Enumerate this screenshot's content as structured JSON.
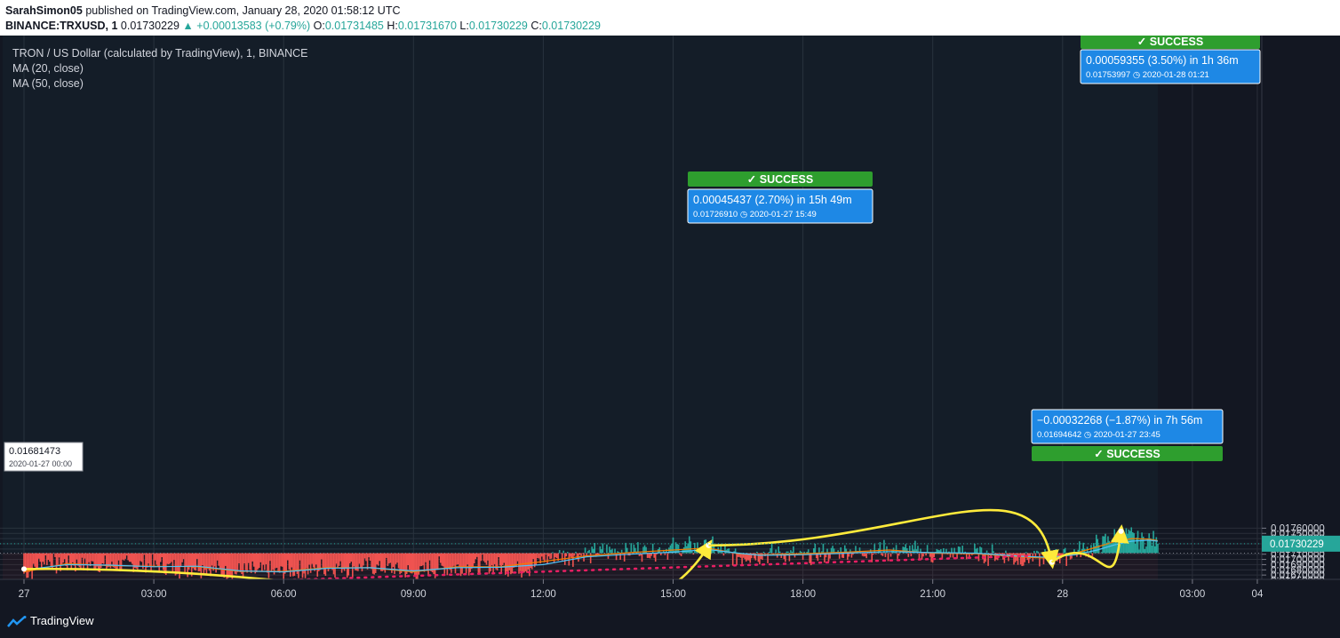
{
  "header": {
    "author": "SarahSimon05",
    "published_text": "published on TradingView.com, January 28, 2020 01:58:12 UTC",
    "symbol": "BINANCE:TRXUSD, 1",
    "last_price": "0.01730229",
    "change": "▲ +0.00013583 (+0.79%)",
    "open_label": "O:",
    "open": "0.01731485",
    "high_label": "H:",
    "high": "0.01731670",
    "low_label": "L:",
    "low": "0.01730229",
    "close_label": "C:",
    "close": "0.01730229"
  },
  "legend": {
    "title": "TRON / US Dollar (calculated by TradingView), 1, BINANCE",
    "ma20": "MA (20, close)",
    "ma50": "MA (50, close)"
  },
  "footer": {
    "brand": "TradingView"
  },
  "colors": {
    "background": "#131722",
    "above_baseline": "#26a69a",
    "below_baseline": "#ef5350",
    "ma20": "#f57c00",
    "ma50": "#4fc3f7",
    "arrow": "#ffeb3b",
    "trendline": "#e91e63",
    "success": "#2e9e2e",
    "info_box": "#1e88e5"
  },
  "chart_data": {
    "type": "area",
    "baseline_price": 0.01712,
    "x_tick_labels": [
      "27",
      "03:00",
      "06:00",
      "09:00",
      "12:00",
      "15:00",
      "18:00",
      "21:00",
      "28",
      "03:00",
      "04"
    ],
    "y_tick_labels": [
      "0.01760000",
      "0.01750000",
      "0.01740000",
      "0.01730000",
      "0.01720000",
      "0.01710000",
      "0.01700000",
      "0.01690000",
      "0.01680000",
      "0.01670000",
      "0.01660000"
    ],
    "ylim": [
      0.0166,
      0.01768
    ],
    "current_price_label": "0.01730229",
    "series": [
      {
        "type": "price",
        "x_hours": [
          0,
          0.25,
          0.5,
          0.75,
          1,
          1.5,
          2,
          2.5,
          3,
          3.5,
          4,
          4.5,
          5,
          5.5,
          6,
          6.5,
          7,
          7.5,
          8,
          8.5,
          9,
          9.5,
          10,
          10.5,
          11,
          11.5,
          11.8,
          12,
          12.5,
          13,
          13.5,
          14,
          14.5,
          15,
          15.5,
          15.82,
          16.2,
          16.5,
          17,
          17.5,
          18,
          18.5,
          19,
          19.5,
          20,
          20.5,
          21,
          21.5,
          22,
          22.5,
          23,
          23.5,
          23.75,
          24,
          24.3,
          24.6,
          24.9,
          25.2,
          25.5,
          25.8,
          26.0,
          26.2
        ],
        "values": [
          0.01673,
          0.01682,
          0.017,
          0.0169,
          0.01694,
          0.0169,
          0.01686,
          0.01689,
          0.01688,
          0.01684,
          0.01688,
          0.01678,
          0.01674,
          0.01676,
          0.01676,
          0.01678,
          0.01684,
          0.01686,
          0.01684,
          0.01684,
          0.01671,
          0.01684,
          0.01686,
          0.01688,
          0.01684,
          0.01684,
          0.01687,
          0.01701,
          0.01707,
          0.0171,
          0.01716,
          0.01719,
          0.01716,
          0.01722,
          0.01724,
          0.01726,
          0.01712,
          0.01706,
          0.0171,
          0.01714,
          0.01704,
          0.01712,
          0.01713,
          0.01717,
          0.01716,
          0.01716,
          0.0171,
          0.01713,
          0.0171,
          0.01708,
          0.017,
          0.01704,
          0.017,
          0.01708,
          0.01713,
          0.0172,
          0.01732,
          0.01741,
          0.01746,
          0.0174,
          0.01738,
          0.0173
        ]
      },
      {
        "name": "MA (20, close)",
        "x_hours": [
          0,
          1,
          2,
          3,
          4,
          5,
          6,
          7,
          8,
          9,
          10,
          11,
          12,
          13,
          14,
          15,
          15.8,
          16.5,
          17,
          18,
          19,
          20,
          21,
          22,
          23,
          23.7,
          24.3,
          24.8,
          25.2,
          25.6,
          26.0,
          26.2
        ],
        "values": [
          0.01676,
          0.01692,
          0.01688,
          0.01687,
          0.01686,
          0.01677,
          0.01677,
          0.01684,
          0.01684,
          0.01676,
          0.01686,
          0.01686,
          0.01696,
          0.01707,
          0.01713,
          0.01718,
          0.01722,
          0.01711,
          0.01709,
          0.01711,
          0.01714,
          0.01718,
          0.01712,
          0.01711,
          0.01705,
          0.01702,
          0.01712,
          0.01724,
          0.01734,
          0.0174,
          0.01739,
          0.01736
        ]
      },
      {
        "name": "MA (50, close)",
        "x_hours": [
          0,
          1,
          2,
          3,
          4,
          5,
          6,
          7,
          8,
          9,
          10,
          11,
          12,
          13,
          14,
          15,
          15.8,
          16.5,
          17,
          18,
          19,
          20,
          21,
          22,
          23,
          23.7,
          24.3,
          24.8,
          25.2,
          25.6,
          26.0,
          26.2
        ],
        "values": [
          0.0168,
          0.0169,
          0.01689,
          0.01686,
          0.01687,
          0.01678,
          0.01676,
          0.01683,
          0.01684,
          0.01678,
          0.01684,
          0.01685,
          0.0169,
          0.01705,
          0.0171,
          0.01714,
          0.01719,
          0.01712,
          0.01708,
          0.01709,
          0.01712,
          0.01715,
          0.01713,
          0.01712,
          0.01706,
          0.01704,
          0.01709,
          0.01718,
          0.01728,
          0.01735,
          0.01737,
          0.01735
        ]
      }
    ],
    "start_marker": {
      "price": "0.01681473",
      "time": "2020-01-27 00:00"
    },
    "annotations": [
      {
        "status": "✓ SUCCESS",
        "change": "0.00045437 (2.70%) in 15h 49m",
        "price": "0.01726910",
        "time": "2020-01-27  15:49"
      },
      {
        "status": "✓ SUCCESS",
        "change": "−0.00032268 (−1.87%) in 7h 56m",
        "price": "0.01694642",
        "time": "2020-01-27  23:45"
      },
      {
        "status": "✓ SUCCESS",
        "change": "0.00059355 (3.50%) in 1h 36m",
        "price": "0.01753997",
        "time": "2020-01-28  01:21"
      }
    ],
    "trendline": {
      "style": "dotted",
      "from": [
        5.9,
        0.0166
      ],
      "to": [
        23.3,
        0.01707
      ]
    },
    "arrows": [
      {
        "from": [
          0,
          0.016815
        ],
        "to": [
          15.82,
          0.0172691
        ]
      },
      {
        "from": [
          15.82,
          0.0172691
        ],
        "to": [
          23.75,
          0.0169464
        ]
      },
      {
        "from": [
          23.75,
          0.0169464
        ],
        "to": [
          25.35,
          0.01754
        ]
      }
    ]
  }
}
